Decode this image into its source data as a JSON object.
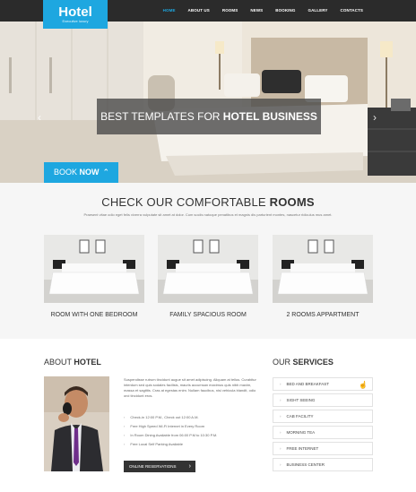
{
  "logo": {
    "brand": "Hotel",
    "tagline": "Executive luxury"
  },
  "nav": {
    "items": [
      "HOME",
      "ABOUT US",
      "ROOMS",
      "NEWS",
      "BOOKING",
      "GALLERY",
      "CONTACTS"
    ],
    "active_index": 0
  },
  "hero": {
    "caption_prefix": "BEST TEMPLATES FOR ",
    "caption_bold": "HOTEL BUSINESS",
    "prev_icon": "‹",
    "next_icon": "›"
  },
  "book": {
    "prefix": "BOOK ",
    "bold": "NOW",
    "icon": "⌃"
  },
  "rooms": {
    "title_prefix": "CHECK OUR COMFORTABLE ",
    "title_bold": "ROOMS",
    "subtitle": "Praesent vitae odio eget felis viverra vulputate sit amet at dolor. Cum sociis natoque penatibus et magnis dis parturient montes, nascetur ridiculus mus amet.",
    "cards": [
      {
        "caption": "ROOM WITH ONE BEDROOM"
      },
      {
        "caption": "FAMILY SPACIOUS ROOM"
      },
      {
        "caption": "2 ROOMS APPARTMENT"
      }
    ]
  },
  "about": {
    "title_prefix": "ABOUT ",
    "title_bold": "HOTEL",
    "text": "Suspendisse rutrum tincidunt augue sit amet adipiscing. Aliquam at tellus. Curabitur interdum sed quis sodales facilisis, mauris accumsan maximus quis nibh maxim, massa et sagittis. Cras at egestas enim. Nullam faucibus, nisi vehicula blandit, odio orci tincidunt eros.",
    "features": [
      "Check-in 12:00 P.M., Check out 12:00 A.M.",
      "Free High Speed Wi-Fi Internet in Every Room",
      "In Room Dining Available from 06:00 P.M to 10:30 P.M.",
      "Free Local Self Parking Available"
    ],
    "button": "ONLINE RESERVATIONS",
    "button_icon": "›"
  },
  "services": {
    "title_prefix": "OUR ",
    "title_bold": "SERVICES",
    "items": [
      "BED AND BREAKFAST",
      "SIGHT SEEING",
      "CAB FACILITY",
      "MORNING TEA",
      "FREE INTERNET",
      "BUSINESS CENTER"
    ]
  },
  "colors": {
    "accent": "#1ea7e0",
    "nav_bg": "#2b2b2b",
    "dark_button": "#333333"
  }
}
